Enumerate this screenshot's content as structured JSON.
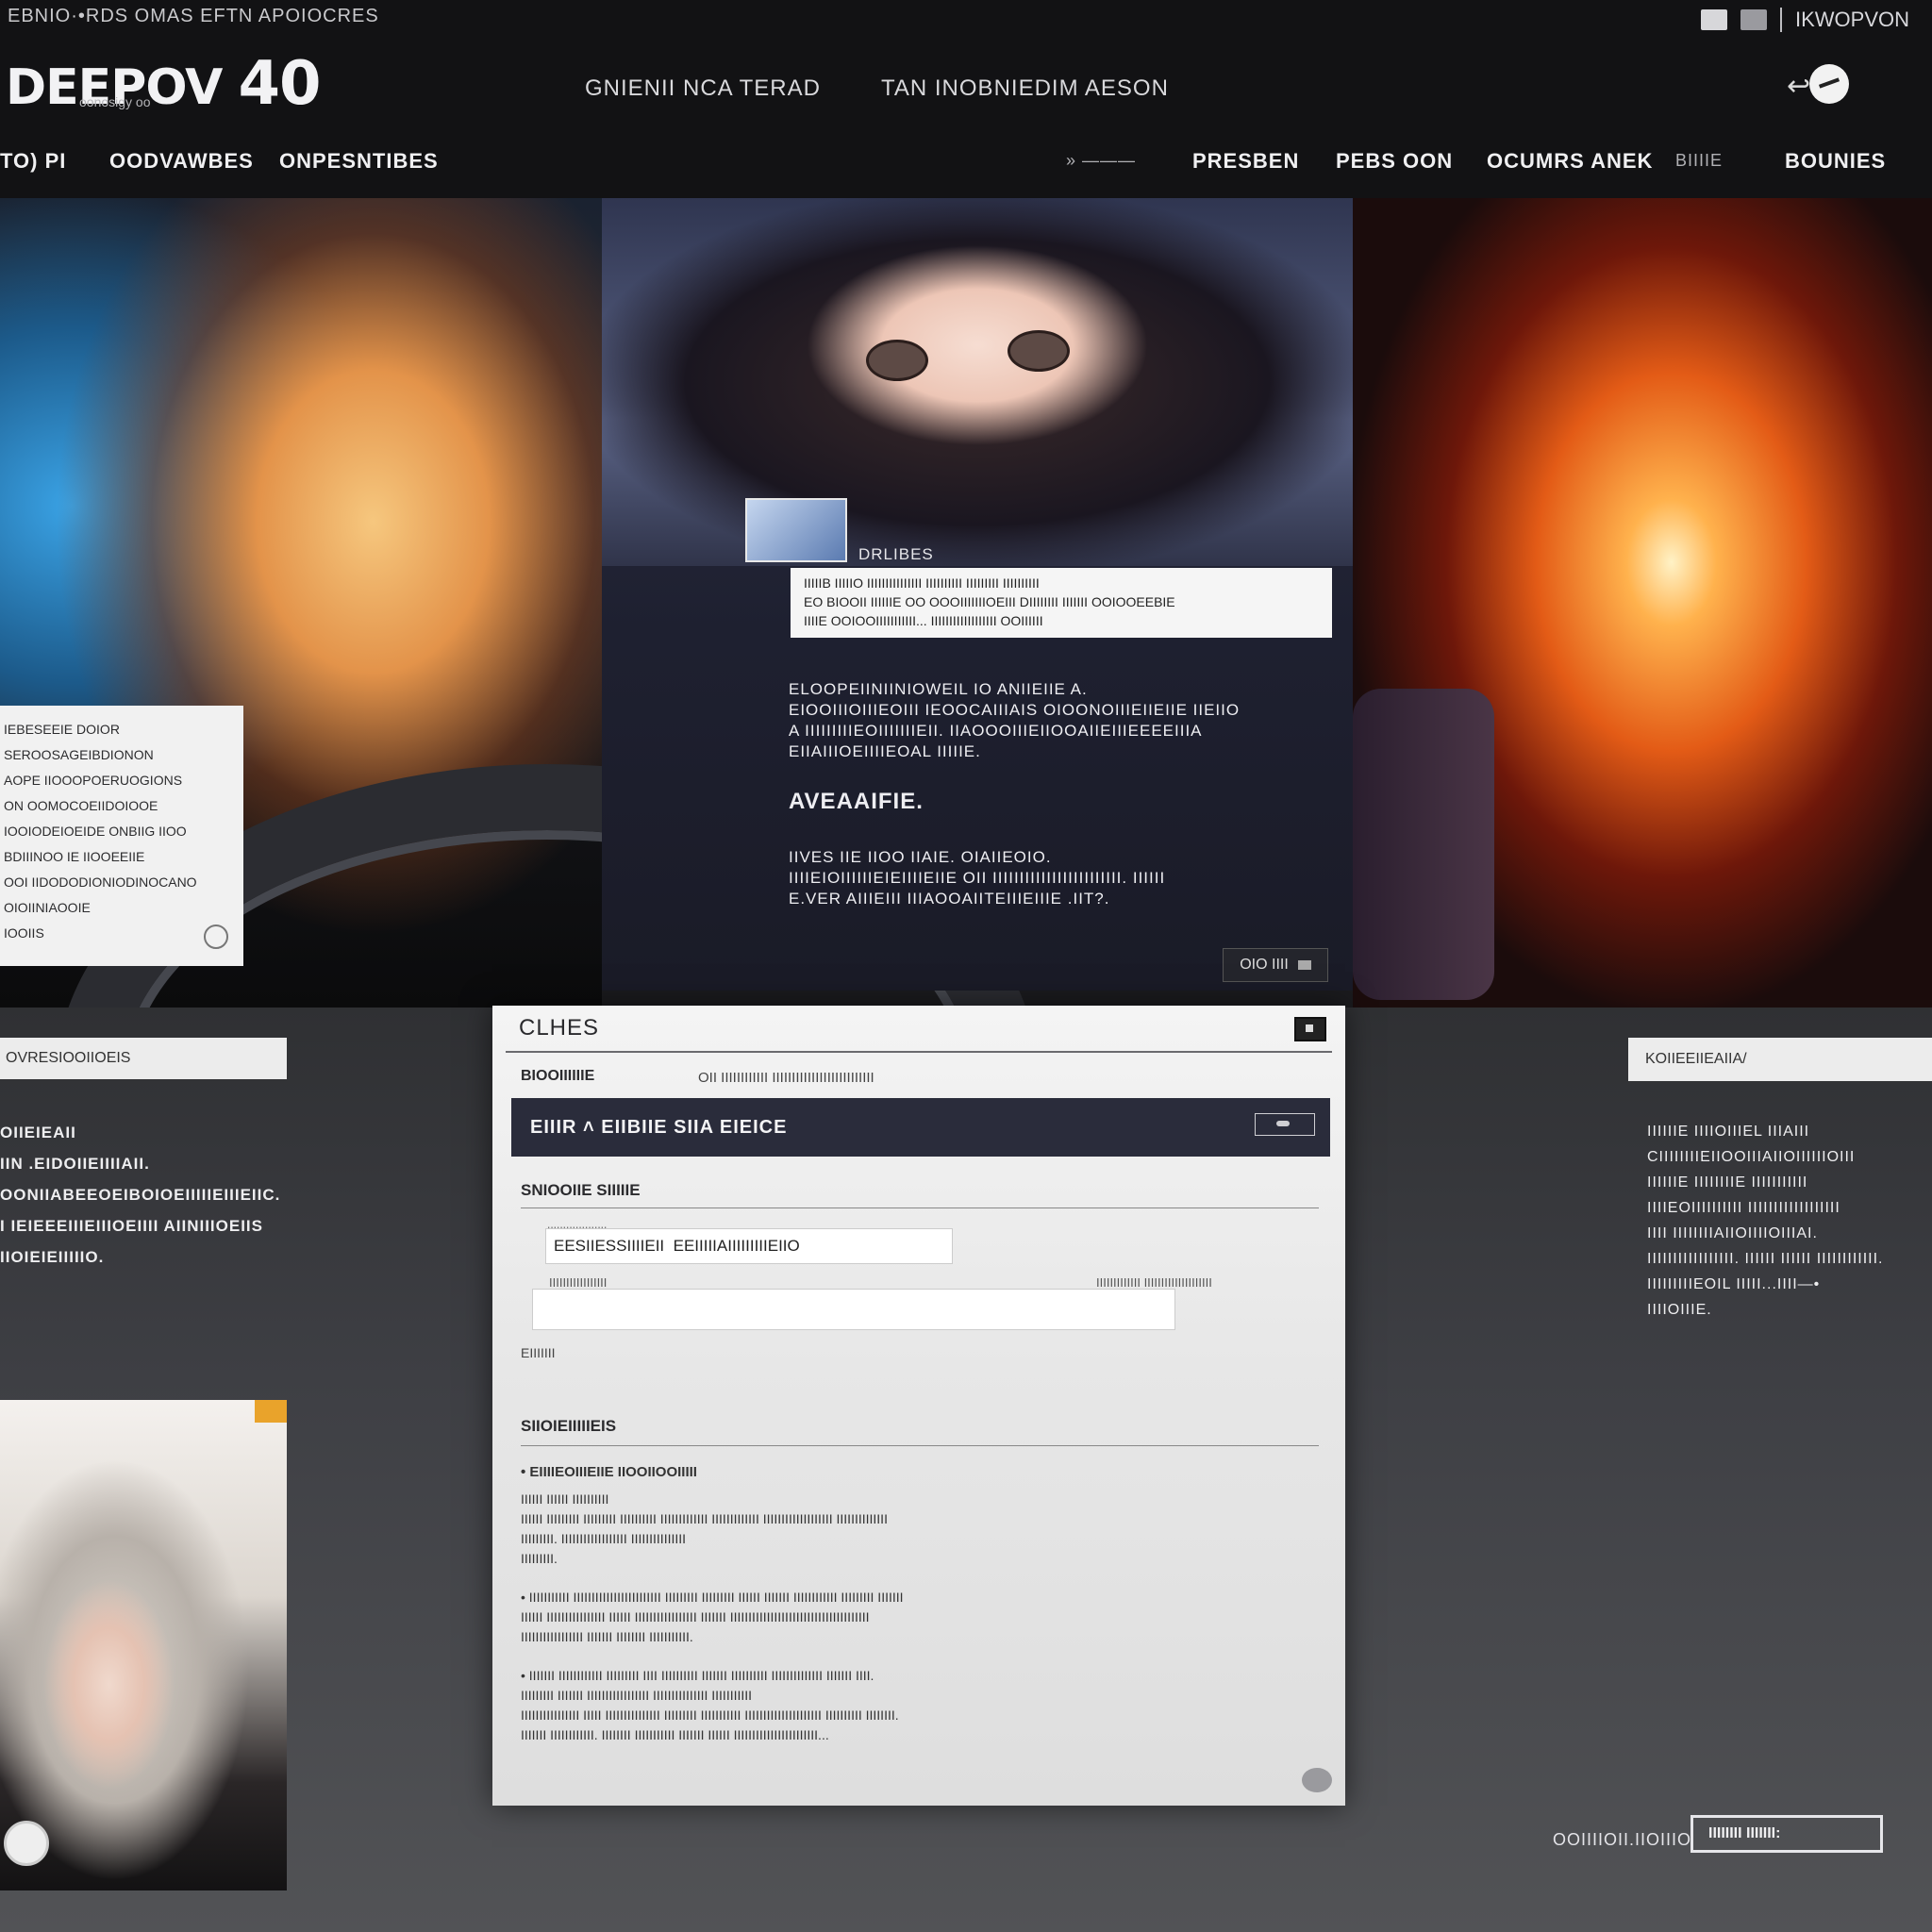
{
  "topbar": {
    "tiny_text": "EBNIO·•RDS OMAS EFTN APOIOCRES",
    "account_label": "IKWOPVON"
  },
  "logo": {
    "text": "DEEPOV",
    "number": "40",
    "sub": "oonosigy oo"
  },
  "hero_links": [
    "GNIENII NCA TERAD",
    "TAN INOBNIEDIM AESON"
  ],
  "nav_left": [
    "TO) PI",
    "OODVAWBES",
    "ONPESNTIBES"
  ],
  "nav_right": {
    "dim_item": "» ———",
    "items": [
      "PRESBEN",
      "PEBS OON",
      "OCUMRS ANEK",
      "BIIIIE",
      "BOUNIES"
    ]
  },
  "left_card": {
    "rows": [
      "IEBESEEIE DOIOR",
      "SEROOSAGEIBDIONON",
      "AOPE IIOOOPOERUOGIONS",
      "ON OOMOCOEIIDOIOOE",
      "IOOIODEIOEIDE ONBIIG IIOO",
      "BDIIINOO IE IIOOEEIIE",
      "OOI IIDODODIONIODINOCANO",
      "OIOIINIAOOIE",
      "IOOIIS"
    ]
  },
  "thumb_label": "DRLIBES",
  "quote_box": {
    "lines": [
      "IIIIIB IIIIIO IIIIIIIIIIIIIII IIIIIIIIII IIIIIIIII  IIIIIIIIII",
      "EO BIOOII IIIIIIE OO OOOIIIIIIIOEIII DIIIIIIII IIIIIII OOIOOEEBIE",
      "IIIIE OOIOOIIIIIIIIIII... IIIIIIIIIIIIIIIIII OOIIIIII"
    ]
  },
  "center_text": {
    "para1": [
      "ELOOPEIINIINIOWEIL IO ANIIEIIE A.",
      "EIOOIIIOIIIEOIII  IEOOCAIIIAIS OIOONOIIIEIIEIIE  IIEIIO",
      "A IIIIIIIIIEOIIIIIIIEII. IIAOOOIIIEIIOOAIIEIIIEEEEIIIA",
      "EIIAIIIOEIIIIEOAL IIIIIE."
    ],
    "heading": "AVEAAIFIE.",
    "para2": [
      "IIVES IIE IIOO IIAIE. OIAIIEOIO.",
      "IIIIEIOIIIIIIEIEIIIIEIIE  OII IIIIIIIIIIIIIIIIIIIIIIII. IIIIII",
      "E.VER AIIIEIII IIIAOOAIITEIIIEIIIE .IIT?."
    ],
    "badge": "OIO IIII"
  },
  "left_tab": "OVRESIOOIIOEIS",
  "left_list": [
    "OIIEIEAII",
    "IIN .EIDOIIEIIIIAII.",
    "OONIIABEEOEIBOIOEIIIIIEIIIEIIC.",
    "I  IEIEEEIIIEIIIOEIIII  AIINIIIOEIIS",
    "IIOIEIEIIIIIO."
  ],
  "right_tab": "KOIIEEIIEAIIA/",
  "right_list": [
    "IIIIIIE IIIIOIIIEL  IIIAIII",
    "CIIIIIIIIEIIOOIIIAIIOIIIIIIOIII",
    "IIIIIIE  IIIIIIIIE  IIIIIIIIIII",
    "IIIIEOIIIIIIIIII  IIIIIIIIIIIIIIIIII",
    "IIII IIIIIIIIAIIOIIIIOIIIAI.",
    "IIIIIIIIIIIIIIIII. IIIIII  IIIIII IIIIIIIIIIII.",
    "IIIIIIIIIEOIL  IIIII...IIII—•",
    "IIIIOIIIE."
  ],
  "dialog": {
    "title": "CLHES",
    "tab1": "BIOOIIIIIIE",
    "tab2": "OII IIIIIIIIIIII IIIIIIIIIIIIIIIIIIIIIIIIII",
    "bar_title": "EIIIR ˄ EIIBIIE SIIA EIEICE",
    "section1": "SNIOOIIE  SIIIIIE",
    "input1_label": "IIIIIIIIIIIIIIIIIII",
    "input1_value": "EESIIESSIIIIEII  EEIIIIIAIIIIIIIIIEIIO",
    "input2_label": "IIIIIIIIIIIIIIIII",
    "input2_label_right": "IIIIIIIIIIIII  IIIIIIIIIIIIIIIIIIII",
    "small_label": "EIIIIIII",
    "section2": "SIIOIEIIIIIEIS",
    "items": [
      {
        "head": "• EIIIIEOIIIEIIE  IIOOIIOOIIIII",
        "lines": [
          "IIIIII  IIIIII IIIIIIIIII",
          "IIIIII IIIIIIIII  IIIIIIIII  IIIIIIIIII  IIIIIIIIIIIII  IIIIIIIIIIIII  IIIIIIIIIIIIIIIIIII IIIIIIIIIIIIII",
          "IIIIIIIII.  IIIIIIIIIIIIIIIIII IIIIIIIIIIIIIII",
          "IIIIIIIII."
        ]
      },
      {
        "head": "",
        "lines": [
          "• IIIIIIIIIII  IIIIIIIIIIIIIIIIIIIIIIII  IIIIIIIII  IIIIIIIII  IIIIII IIIIIII  IIIIIIIIIIII  IIIIIIIII  IIIIIII",
          "IIIIII  IIIIIIIIIIIIIIII  IIIIII IIIIIIIIIIIIIIIII  IIIIIII  IIIIIIIIIIIIIIIIIIIIIIIIIIIIIIIIIIIIII",
          "IIIIIIIIIIIIIIIII  IIIIIII  IIIIIIII IIIIIIIIIII."
        ]
      },
      {
        "head": "",
        "lines": [
          "• IIIIIII IIIIIIIIIIII  IIIIIIIII IIII IIIIIIIIII  IIIIIII  IIIIIIIIII  IIIIIIIIIIIIII  IIIIIII IIII.",
          "IIIIIIIII IIIIIII  IIIIIIIIIIIIIIIII IIIIIIIIIIIIIII IIIIIIIIIII",
          "IIIIIIIIIIIIIIII  IIIII  IIIIIIIIIIIIIII  IIIIIIIII  IIIIIIIIIII  IIIIIIIIIIIIIIIIIIIII  IIIIIIIIII  IIIIIIII.",
          "IIIIIII  IIIIIIIIIIII.  IIIIIIII  IIIIIIIIIII  IIIIIII  IIIIII  IIIIIIIIIIIIIIIIIIIIIII..."
        ]
      }
    ]
  },
  "bottom_right": {
    "label": "OOIIIIOII.IIOIIIO",
    "button": "IIIIIIII IIIIIII:"
  }
}
